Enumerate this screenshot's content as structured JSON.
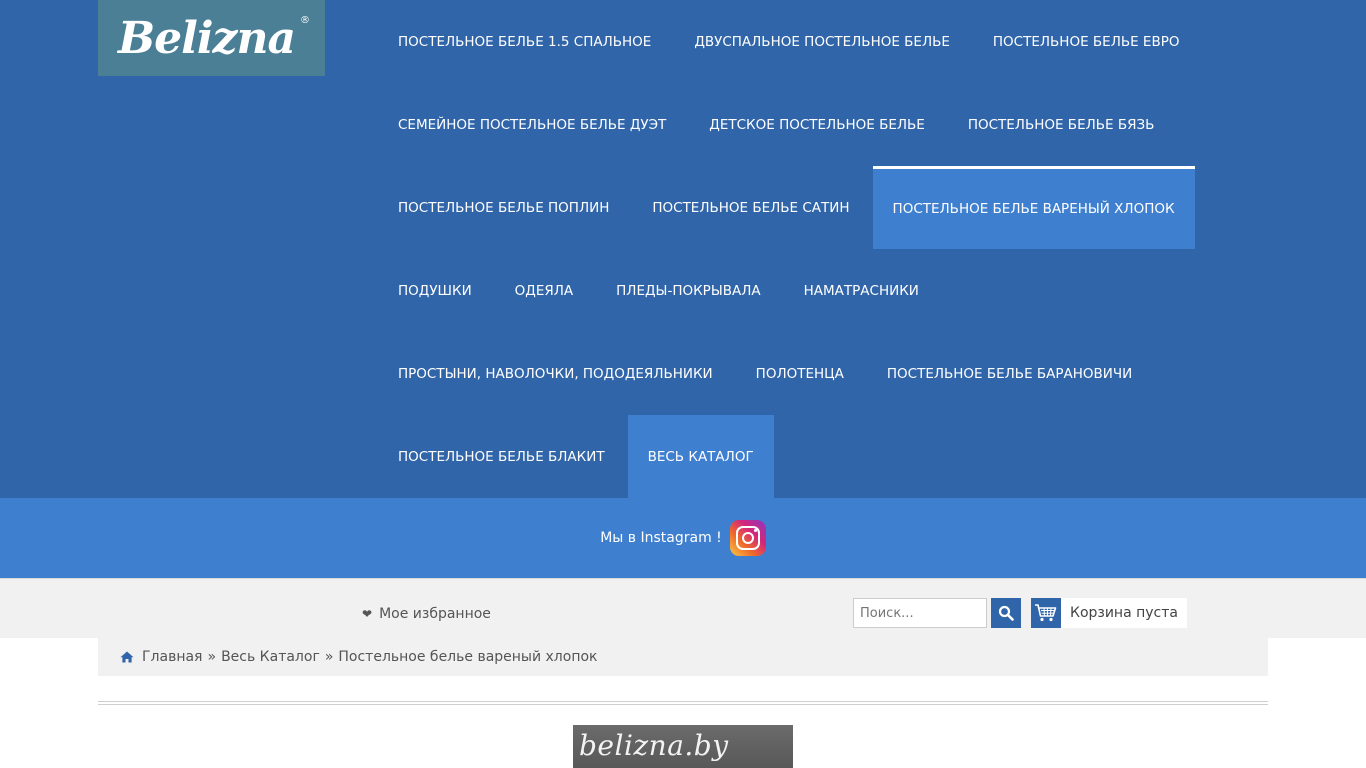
{
  "logo": {
    "text": "Belizna",
    "registered": "®"
  },
  "nav": {
    "rows": [
      [
        {
          "label": "Постельное белье 1.5 спальное"
        },
        {
          "label": "Двуспальное постельное белье"
        },
        {
          "label": "Постельное белье Евро"
        }
      ],
      [
        {
          "label": "Семейное постельное белье Дуэт"
        },
        {
          "label": "Детское постельное белье"
        },
        {
          "label": "Постельное белье бязь"
        }
      ],
      [
        {
          "label": "Постельное белье поплин"
        },
        {
          "label": "Постельное белье сатин"
        },
        {
          "label": "Постельное белье вареный хлопок",
          "state": "active"
        }
      ],
      [
        {
          "label": "Подушки"
        },
        {
          "label": "Одеяла"
        },
        {
          "label": "Пледы-покрывала"
        },
        {
          "label": "Наматрасники"
        }
      ],
      [
        {
          "label": "Простыни, наволочки, пододеяльники"
        },
        {
          "label": "Полотенца"
        },
        {
          "label": "Постельное белье Барановичи"
        }
      ],
      [
        {
          "label": "Постельное белье Блакит"
        },
        {
          "label": "Весь каталог",
          "state": "highlight"
        }
      ]
    ]
  },
  "instagram": {
    "text": "Мы в Instagram !",
    "icon": "instagram-icon"
  },
  "toolbar": {
    "favorites_label": "Мое избранное",
    "search_placeholder": "Поиск...",
    "cart_label": "Корзина пуста"
  },
  "breadcrumb": {
    "home": "Главная",
    "catalog": "Весь Каталог",
    "current": "Постельное белье вареный хлопок",
    "separator": "»"
  },
  "banner": {
    "text": "belizna.by"
  },
  "colors": {
    "header_bg": "#3165a9",
    "accent": "#3f7fcf",
    "logo_bg": "#4a7f96",
    "toolbar_bg": "#f1f1f1"
  }
}
